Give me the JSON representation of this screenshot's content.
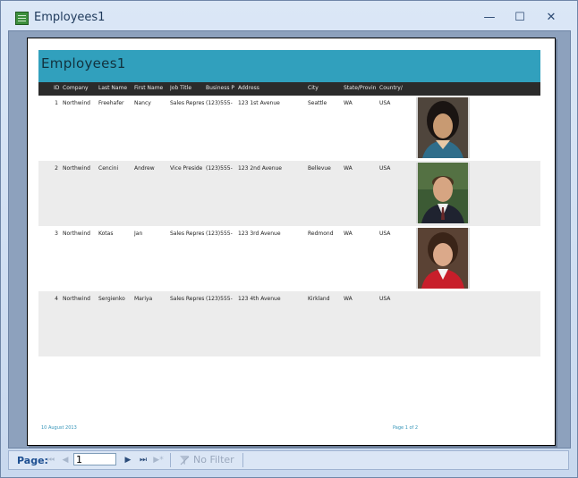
{
  "window": {
    "title": "Employees1"
  },
  "controls": {
    "minimize": "—",
    "maximize": "☐",
    "close": "✕"
  },
  "report": {
    "title": "Employees1",
    "columns": [
      "ID",
      "Company",
      "Last Name",
      "First Name",
      "Job Title",
      "Business P",
      "Address",
      "City",
      "State/Provin",
      "Country/"
    ],
    "rows": [
      {
        "id": "1",
        "company": "Northwind",
        "last": "Freehafer",
        "first": "Nancy",
        "job": "Sales Represe",
        "phone": "(123)555-",
        "address": "123 1st Avenue",
        "city": "Seattle",
        "state": "WA",
        "country": "USA",
        "photo": "woman-dark-hair"
      },
      {
        "id": "2",
        "company": "Northwind",
        "last": "Cencini",
        "first": "Andrew",
        "job": "Vice Preside",
        "phone": "(123)555-",
        "address": "123 2nd Avenue",
        "city": "Bellevue",
        "state": "WA",
        "country": "USA",
        "photo": "man-suit"
      },
      {
        "id": "3",
        "company": "Northwind",
        "last": "Kotas",
        "first": "Jan",
        "job": "Sales Represe",
        "phone": "(123)555-",
        "address": "123 3rd Avenue",
        "city": "Redmond",
        "state": "WA",
        "country": "USA",
        "photo": "woman-red-jacket"
      },
      {
        "id": "4",
        "company": "Northwind",
        "last": "Sergienko",
        "first": "Mariya",
        "job": "Sales Represe",
        "phone": "(123)555-",
        "address": "123 4th Avenue",
        "city": "Kirkland",
        "state": "WA",
        "country": "USA",
        "photo": ""
      }
    ],
    "footer_date": "10 August 2013",
    "footer_page": "Page 1 of 2"
  },
  "navigation": {
    "label": "Page:",
    "current_page": "1",
    "filter_label": "No Filter",
    "icons": [
      "first-page-icon",
      "prev-page-icon",
      "next-page-icon",
      "last-page-icon",
      "new-page-icon",
      "filter-icon"
    ]
  }
}
